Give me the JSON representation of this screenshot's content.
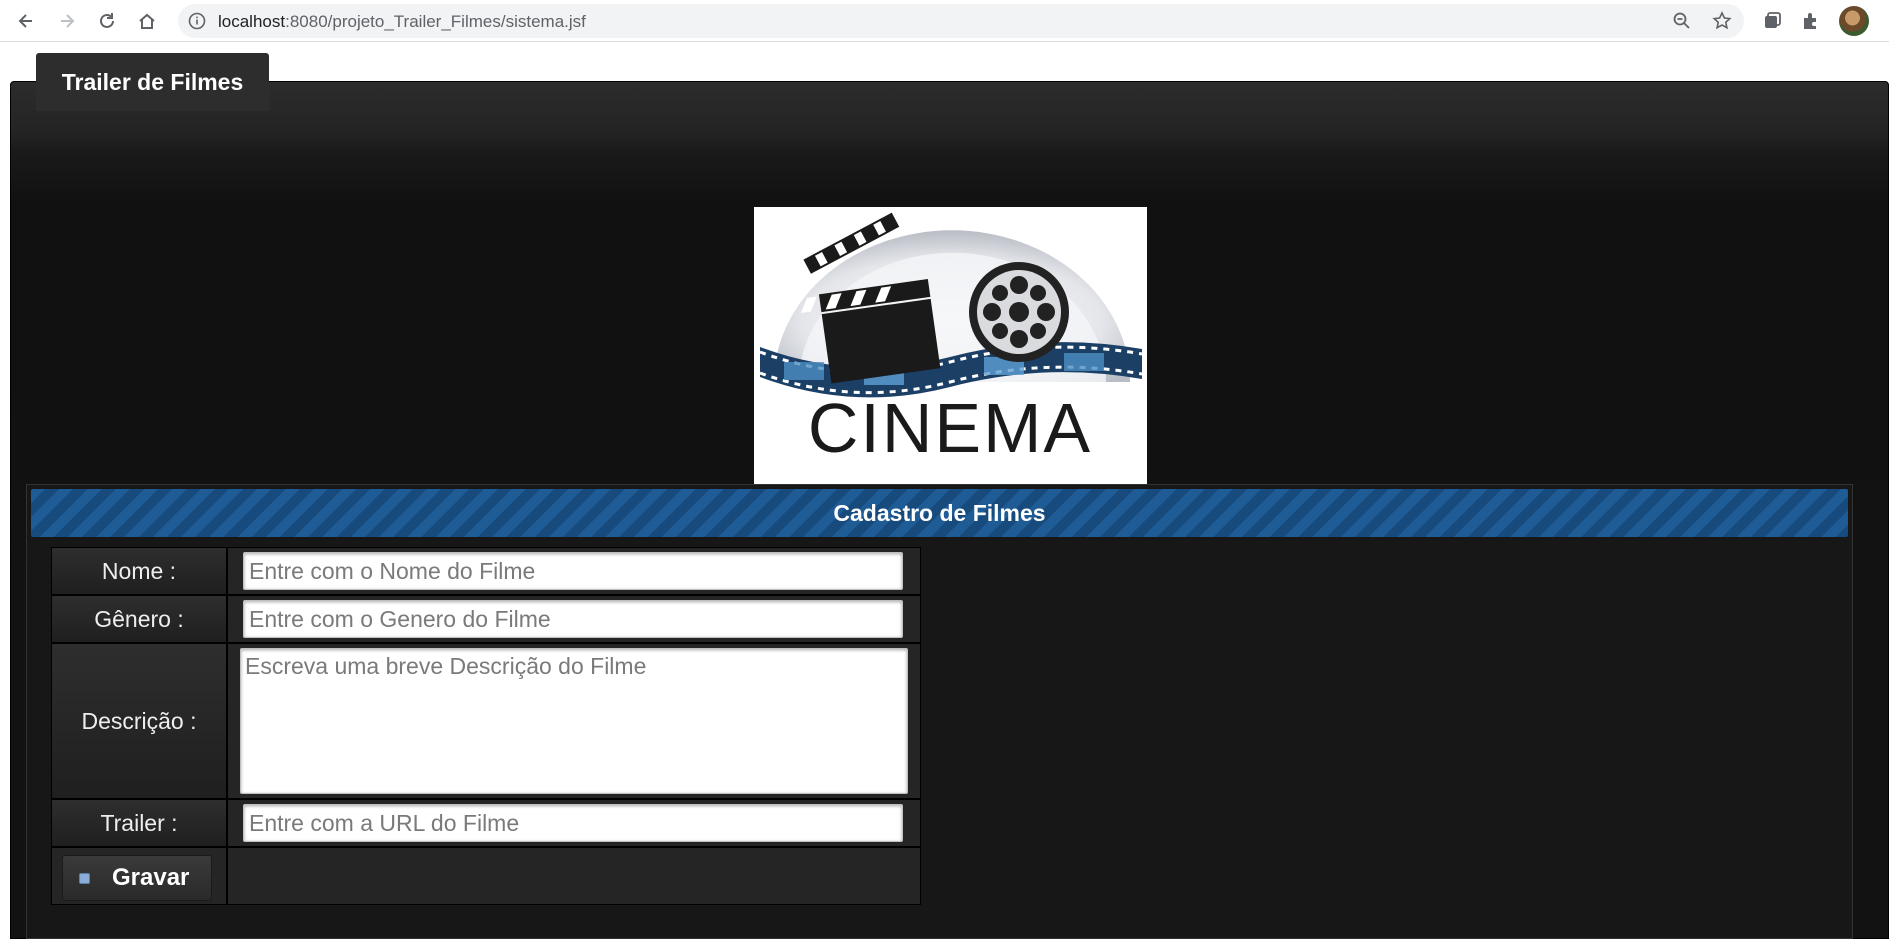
{
  "browser": {
    "url_host": "localhost",
    "url_path": ":8080/projeto_Trailer_Filmes/sistema.jsf"
  },
  "site": {
    "tab_label": "Trailer de Filmes",
    "logo_text": "CINEMA"
  },
  "form": {
    "title": "Cadastro de Filmes",
    "fields": {
      "nome_label": "Nome :",
      "nome_placeholder": "Entre com o Nome do Filme",
      "genero_label": "Gênero :",
      "genero_placeholder": "Entre com o Genero do Filme",
      "descricao_label": "Descrição :",
      "descricao_placeholder": "Escreva uma breve Descrição do Filme",
      "trailer_label": "Trailer :",
      "trailer_placeholder": "Entre com a URL do Filme"
    },
    "save_label": "Gravar"
  }
}
